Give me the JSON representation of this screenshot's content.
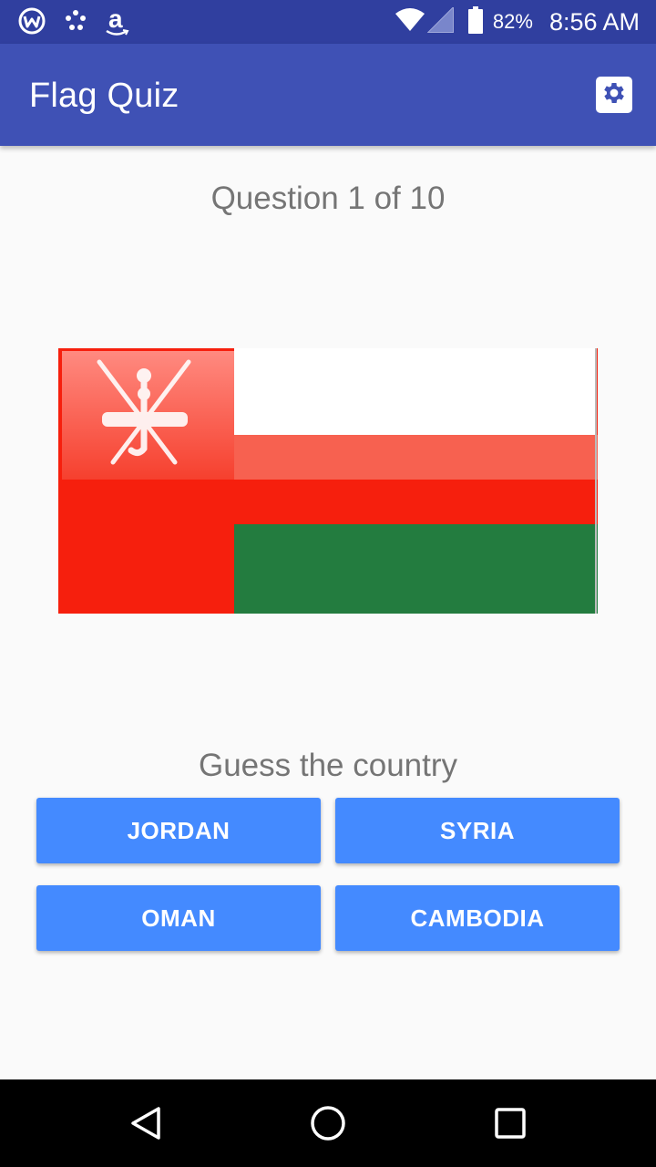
{
  "status_bar": {
    "left_icons": [
      "wink-app-icon",
      "dots-app-icon",
      "amazon-icon"
    ],
    "amazon_glyph": "a",
    "battery_percent": "82%",
    "time": "8:56 AM"
  },
  "app_bar": {
    "title": "Flag Quiz",
    "settings_icon": "gear-icon"
  },
  "quiz": {
    "question_label": "Question 1 of 10",
    "flag": {
      "country_depicted": "Oman",
      "colors": {
        "red": "#f61f0d",
        "white": "#ffffff",
        "green": "#237c3f"
      }
    },
    "prompt": "Guess the country",
    "answers": [
      "JORDAN",
      "SYRIA",
      "OMAN",
      "CAMBODIA"
    ]
  },
  "colors": {
    "status_bar": "#303f9f",
    "app_bar": "#3f51b5",
    "button": "#448aff",
    "background": "#fafafa",
    "text_secondary": "#757575"
  },
  "nav_bar": {
    "buttons": [
      "back-icon",
      "home-icon",
      "recents-icon"
    ]
  }
}
